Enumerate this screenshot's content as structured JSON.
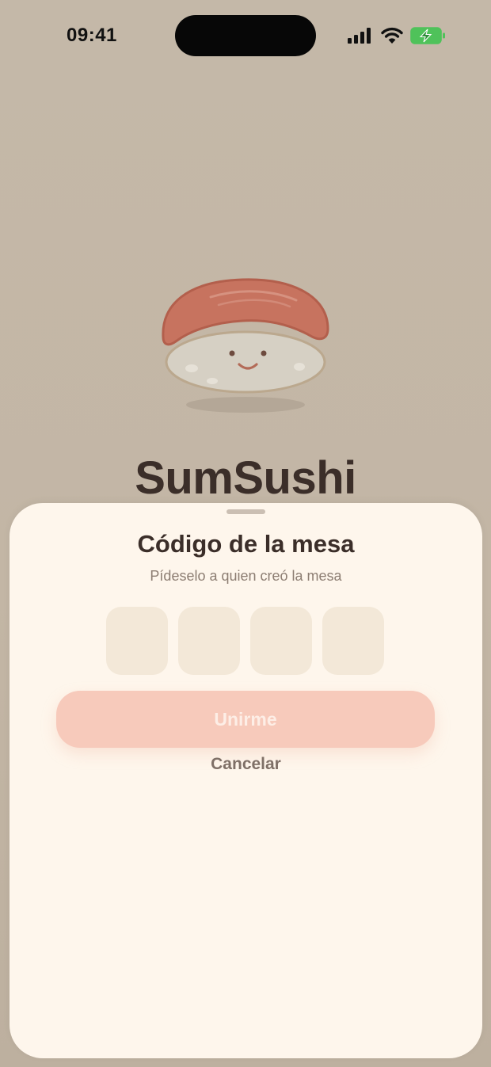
{
  "status_bar": {
    "time": "09:41",
    "icons": [
      "signal-icon",
      "wifi-icon",
      "battery-charging-icon"
    ]
  },
  "hero": {
    "app_name": "SumSushi",
    "mascot": "sushi-mascot-icon"
  },
  "sheet": {
    "title": "Código de la mesa",
    "subtitle": "Pídeselo a quien creó la mesa",
    "code_digits": [
      "",
      "",
      "",
      ""
    ],
    "join_label": "Unirme",
    "cancel_label": "Cancelar"
  },
  "colors": {
    "background": "#c4b8a8",
    "sheet": "#fef6ec",
    "title": "#3b2e29",
    "subtitle": "#8c7d72",
    "code_box": "#f3e8d8",
    "button_disabled": "#f7cabb",
    "button_text": "#fdeee6",
    "battery": "#4fc25a"
  }
}
